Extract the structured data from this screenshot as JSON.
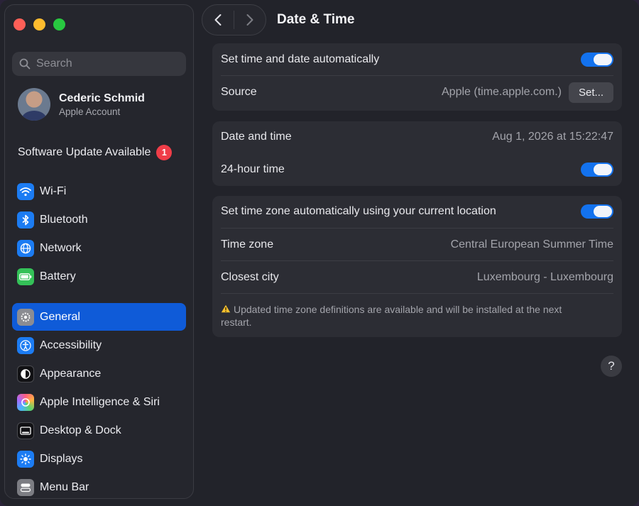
{
  "sidebar": {
    "search_placeholder": "Search",
    "profile": {
      "name": "Cederic Schmid",
      "subtitle": "Apple Account"
    },
    "update": {
      "label": "Software Update Available",
      "count": "1"
    },
    "items": [
      {
        "label": "Wi-Fi",
        "icon": "wifi-icon"
      },
      {
        "label": "Bluetooth",
        "icon": "bluetooth-icon"
      },
      {
        "label": "Network",
        "icon": "globe-icon"
      },
      {
        "label": "Battery",
        "icon": "battery-icon"
      },
      {
        "label": "General",
        "icon": "gear-icon",
        "active": true
      },
      {
        "label": "Accessibility",
        "icon": "accessibility-icon"
      },
      {
        "label": "Appearance",
        "icon": "appearance-icon"
      },
      {
        "label": "Apple Intelligence & Siri",
        "icon": "siri-icon"
      },
      {
        "label": "Desktop & Dock",
        "icon": "dock-icon"
      },
      {
        "label": "Displays",
        "icon": "sun-icon"
      },
      {
        "label": "Menu Bar",
        "icon": "menubar-icon"
      }
    ]
  },
  "toolbar": {
    "title": "Date & Time"
  },
  "groups": {
    "auto_time": {
      "label": "Set time and date automatically",
      "on": true
    },
    "source": {
      "label": "Source",
      "value": "Apple (time.apple.com.)",
      "button": "Set..."
    },
    "date_time": {
      "label": "Date and time",
      "value": "Aug 1, 2026 at 15:22:47"
    },
    "hour24": {
      "label": "24-hour time",
      "on": true
    },
    "auto_zone": {
      "label": "Set time zone automatically using your current location",
      "on": true
    },
    "time_zone": {
      "label": "Time zone",
      "value": "Central European Summer Time"
    },
    "closest_city": {
      "label": "Closest city",
      "value": "Luxembourg - Luxembourg"
    },
    "warning": "Updated time zone definitions are available and will be installed at the next restart."
  },
  "help_label": "?",
  "colors": {
    "accent": "#0f5bd8",
    "toggle_on": "#1372ee",
    "badge": "#ef3d48"
  }
}
